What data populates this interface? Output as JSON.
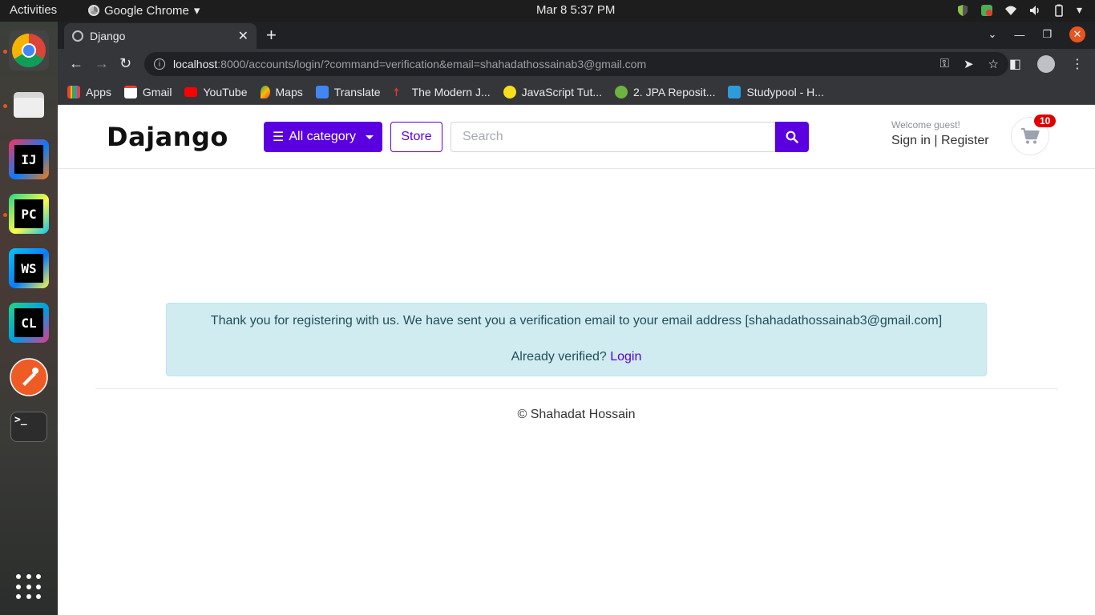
{
  "system": {
    "activities": "Activities",
    "app_name": "Google Chrome",
    "clock": "Mar 8  5:37 PM"
  },
  "dock": {
    "items": [
      {
        "name": "Google Chrome",
        "label": ""
      },
      {
        "name": "Files",
        "label": ""
      },
      {
        "name": "IntelliJ IDEA",
        "label": "IJ"
      },
      {
        "name": "PyCharm",
        "label": "PC"
      },
      {
        "name": "WebStorm",
        "label": "WS"
      },
      {
        "name": "CLion",
        "label": "CL"
      },
      {
        "name": "Postman",
        "label": ""
      },
      {
        "name": "Terminal",
        "label": ">_"
      }
    ]
  },
  "browser": {
    "tab_title": "Django",
    "url_host": "localhost",
    "url_rest": ":8000/accounts/login/?command=verification&email=shahadathossainab3@gmail.com",
    "bookmarks": [
      "Apps",
      "Gmail",
      "YouTube",
      "Maps",
      "Translate",
      "The Modern J...",
      "JavaScript Tut...",
      "2. JPA Reposit...",
      "Studypool - H..."
    ]
  },
  "site": {
    "brand": "Dajango",
    "all_category": "All category",
    "store": "Store",
    "search_placeholder": "Search",
    "welcome": "Welcome guest!",
    "sign_in": "Sign in",
    "separator": "|",
    "register": "Register",
    "cart_count": "10"
  },
  "alert": {
    "message": "Thank you for registering with us. We have sent you a verification email to your email address [shahadathossainab3@gmail.com]",
    "verified_prompt": "Already verified?",
    "login_link": "Login"
  },
  "footer": {
    "text": "© Shahadat Hossain"
  },
  "colors": {
    "accent": "#5a00e0",
    "alert_bg": "#d1ecf1",
    "badge": "#e00000"
  }
}
